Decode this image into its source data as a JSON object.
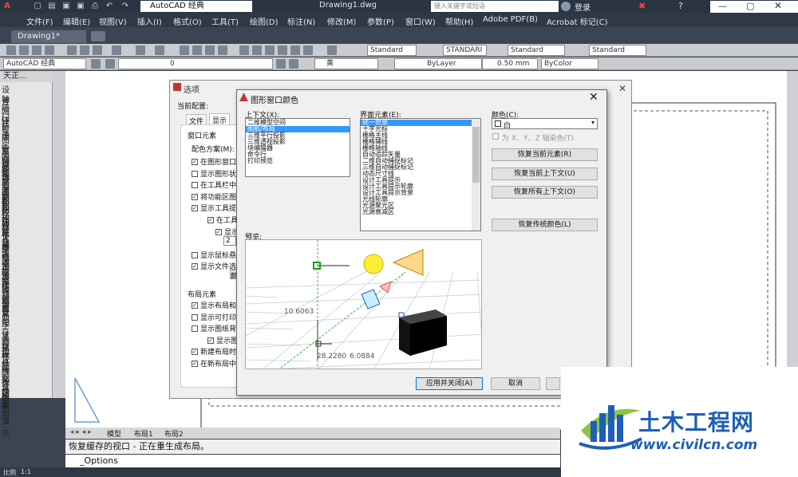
{
  "titlebar": {
    "workspace": "AutoCAD 经典",
    "doc_title": "Drawing1.dwg",
    "search_placeholder": "键入关键字或短语",
    "login": "登录"
  },
  "menu": [
    "文件(F)",
    "编辑(E)",
    "视图(V)",
    "插入(I)",
    "格式(O)",
    "工具(T)",
    "绘图(D)",
    "标注(N)",
    "修改(M)",
    "参数(P)",
    "窗口(W)",
    "帮助(H)",
    "Adobe PDF(B)",
    "Acrobat 标记(C)"
  ],
  "doc_tab": "Drawing1*",
  "toolbar": {
    "text_style": "Standard",
    "dim_style": "STANDARI",
    "table_style": "Standard",
    "mleader_style": "Standard",
    "workspace2": "AutoCAD 经典",
    "layer": "0",
    "color": "黄",
    "linetype": "ByLayer",
    "lineweight": "0.50 mm",
    "plotstyle": "ByColor"
  },
  "left_panel": {
    "header": "天正...",
    "items": [
      "设　置",
      "轴网柱子",
      "墙　体",
      "门　窗",
      "房间屋顶",
      "搜索房间",
      "房间轮廓",
      "房间排序",
      "查询面积",
      "套内面积",
      "公摊面积",
      "面积计算",
      "面积统计",
      "房间布置",
      "搜屋顶线",
      "任意坡顶",
      "人字坡顶",
      "攒尖屋顶",
      "矩形屋顶",
      "加老虎窗",
      "加雨水管",
      "楼梯其他",
      "立　面",
      "剖　面",
      "文字表格",
      "尺寸标注",
      "符号标注",
      "图层控制",
      "工　具",
      "三维建模",
      "图块图案",
      "文件布图",
      "其　它",
      "帮助演示"
    ]
  },
  "options_dialog": {
    "title": "选项",
    "current_profile": "当前配置:",
    "tabs": [
      "文件",
      "显示"
    ],
    "window_elements": "窗口元素",
    "color_scheme": "配色方案(M):",
    "checks": [
      "在图形窗口",
      "显示图形状",
      "在工具栏中",
      "将功能区图",
      "显示工具提",
      "在工具",
      "显示扩",
      "",
      "显示鼠标悬",
      "显示文件选"
    ],
    "spin_value": "2",
    "layout_elements": "布局元素",
    "layout_checks": [
      "显示布局和",
      "显示可打印",
      "显示图纸背",
      "显示图",
      "新建布局时",
      "在新布局中"
    ]
  },
  "color_dialog": {
    "title": "图形窗口颜色",
    "context_label": "上下文(X):",
    "contexts": [
      "二维模型空间",
      "图纸/布局",
      "三维平行投影",
      "三维透视投影",
      "块编辑器",
      "命令行",
      "打印预览"
    ],
    "elements_label": "界面元素(E):",
    "elements": [
      "统一背景",
      "十字光标",
      "栅格主线",
      "栅格辅线",
      "栅格轴线",
      "自动追踪矢量",
      "二维自动捕捉标记",
      "三维自动捕捉标记",
      "动态尺寸线",
      "设计工具提示",
      "设计工具提示轮廓",
      "设计工具提示背景",
      "光线轮廓",
      "光源聚光区",
      "光源衰减区"
    ],
    "color_label": "颜色(C):",
    "color_value": "白",
    "tint_label": "为 X、Y、Z 轴染色(T)",
    "buttons": {
      "restore_element": "恢复当前元素(R)",
      "restore_context": "恢复当前上下文(U)",
      "restore_all": "恢复所有上下文(O)",
      "restore_classic": "恢复传统颜色(L)",
      "apply": "应用并关闭(A)",
      "cancel": "取消"
    },
    "preview_label": "预览:",
    "preview_values": {
      "v1": "10.6063",
      "v2": "28.2280",
      "v3": "6.0884"
    }
  },
  "layout_tabs": [
    "模型",
    "布局1",
    "布局2"
  ],
  "cmd": {
    "history": "恢复缓存的视口 - 正在重生成布局。",
    "prompt": "_Options"
  },
  "status": {
    "scale": "1:1"
  },
  "logo": {
    "main": "土木工程网",
    "url": "www.civilcn.com"
  }
}
